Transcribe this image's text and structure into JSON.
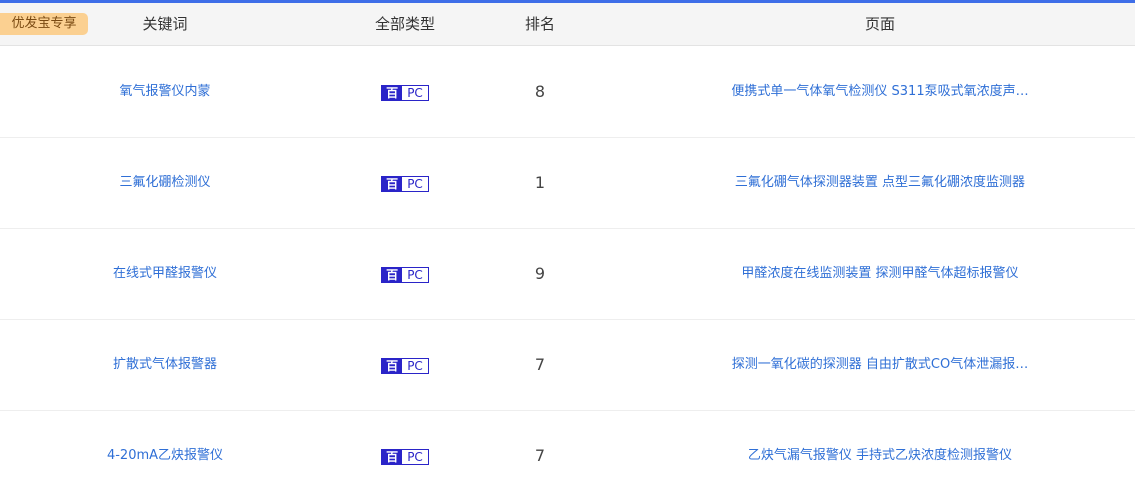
{
  "badge": "优发宝专享",
  "columns": {
    "keyword": "关键词",
    "type": "全部类型",
    "rank": "排名",
    "page": "页面"
  },
  "rows": [
    {
      "keyword": "氧气报警仪内蒙",
      "engine_icon": "百",
      "device": "PC",
      "rank": "8",
      "page": "便携式单一气体氧气检测仪 S311泵吸式氧浓度声…"
    },
    {
      "keyword": "三氟化硼检测仪",
      "engine_icon": "百",
      "device": "PC",
      "rank": "1",
      "page": "三氟化硼气体探测器装置 点型三氟化硼浓度监测器"
    },
    {
      "keyword": "在线式甲醛报警仪",
      "engine_icon": "百",
      "device": "PC",
      "rank": "9",
      "page": "甲醛浓度在线监测装置 探测甲醛气体超标报警仪"
    },
    {
      "keyword": "扩散式气体报警器",
      "engine_icon": "百",
      "device": "PC",
      "rank": "7",
      "page": "探测一氧化碳的探测器 自由扩散式CO气体泄漏报…"
    },
    {
      "keyword": "4-20mA乙炔报警仪",
      "engine_icon": "百",
      "device": "PC",
      "rank": "7",
      "page": "乙炔气漏气报警仪 手持式乙炔浓度检测报警仪"
    }
  ]
}
